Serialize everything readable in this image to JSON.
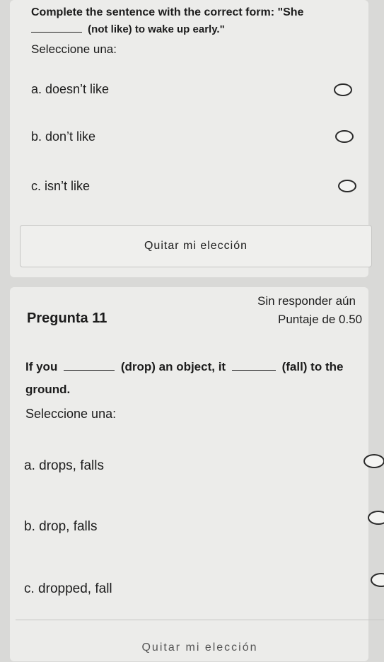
{
  "question10": {
    "text_start": "Complete the sentence with the correct form: \"She",
    "text_end": "(not like) to wake up early.\"",
    "prompt": "Seleccione una:",
    "options": [
      {
        "label": "a. doesn’t like"
      },
      {
        "label": "b. don’t like"
      },
      {
        "label": "c. isn’t like"
      }
    ],
    "clear_label": "Quitar mi elección"
  },
  "question11": {
    "title": "Pregunta 11",
    "status": "Sin responder aún",
    "score": "Puntaje de 0.50",
    "text_part1": "If you",
    "text_part2": "(drop) an object, it",
    "text_part3": "(fall) to the",
    "text_line2": "ground.",
    "prompt": "Seleccione una:",
    "options": [
      {
        "label": "a. drops, falls"
      },
      {
        "label": "b. drop, falls"
      },
      {
        "label": "c. dropped, fall"
      }
    ],
    "clear_label": "Quitar mi elección"
  }
}
